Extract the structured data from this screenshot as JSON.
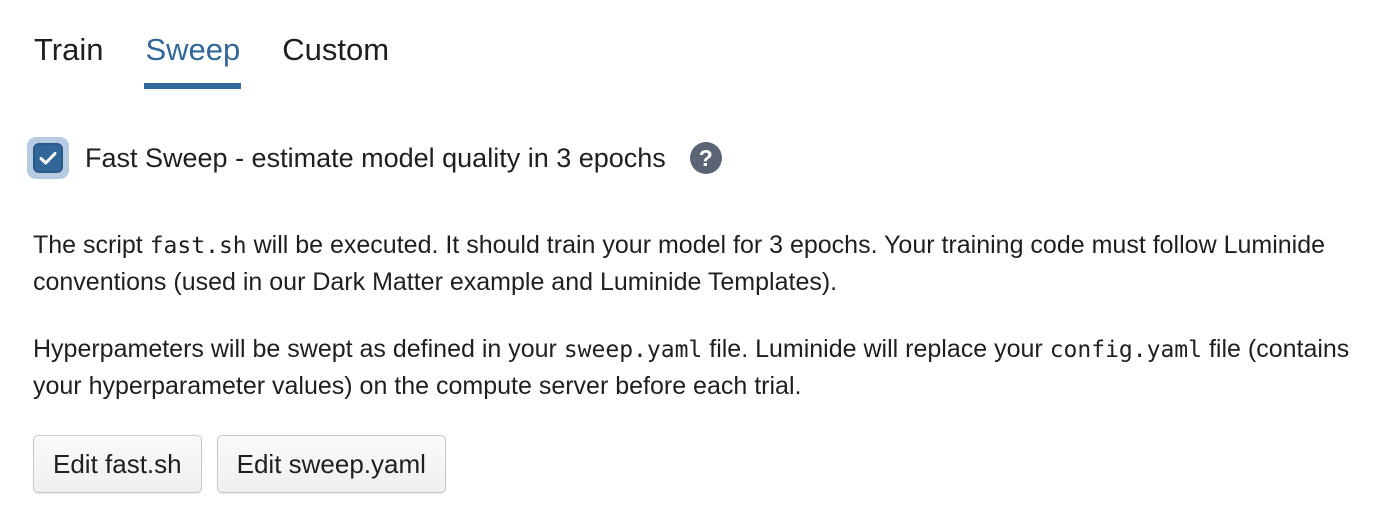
{
  "tabs": [
    {
      "label": "Train",
      "active": false
    },
    {
      "label": "Sweep",
      "active": true
    },
    {
      "label": "Custom",
      "active": false
    }
  ],
  "fast_sweep": {
    "checked": true,
    "label": "Fast Sweep - estimate model quality in 3 epochs",
    "help_icon": "question-circle-icon"
  },
  "paragraph1": {
    "t1": "The script ",
    "code1": "fast.sh",
    "t2": " will be executed. It should train your model for 3 epochs. Your training code must follow Luminide conventions (used in our Dark Matter example and Luminide Templates)."
  },
  "paragraph2": {
    "t1": "Hyperpameters will be swept as defined in your ",
    "code1": "sweep.yaml",
    "t2": " file. Luminide will replace your ",
    "code2": "config.yaml",
    "t3": " file (contains your hyperparameter values) on the compute server before each trial."
  },
  "buttons": {
    "edit_fast": "Edit fast.sh",
    "edit_sweep": "Edit sweep.yaml"
  },
  "colors": {
    "accent": "#336699",
    "help_icon_bg": "#5a6475"
  }
}
